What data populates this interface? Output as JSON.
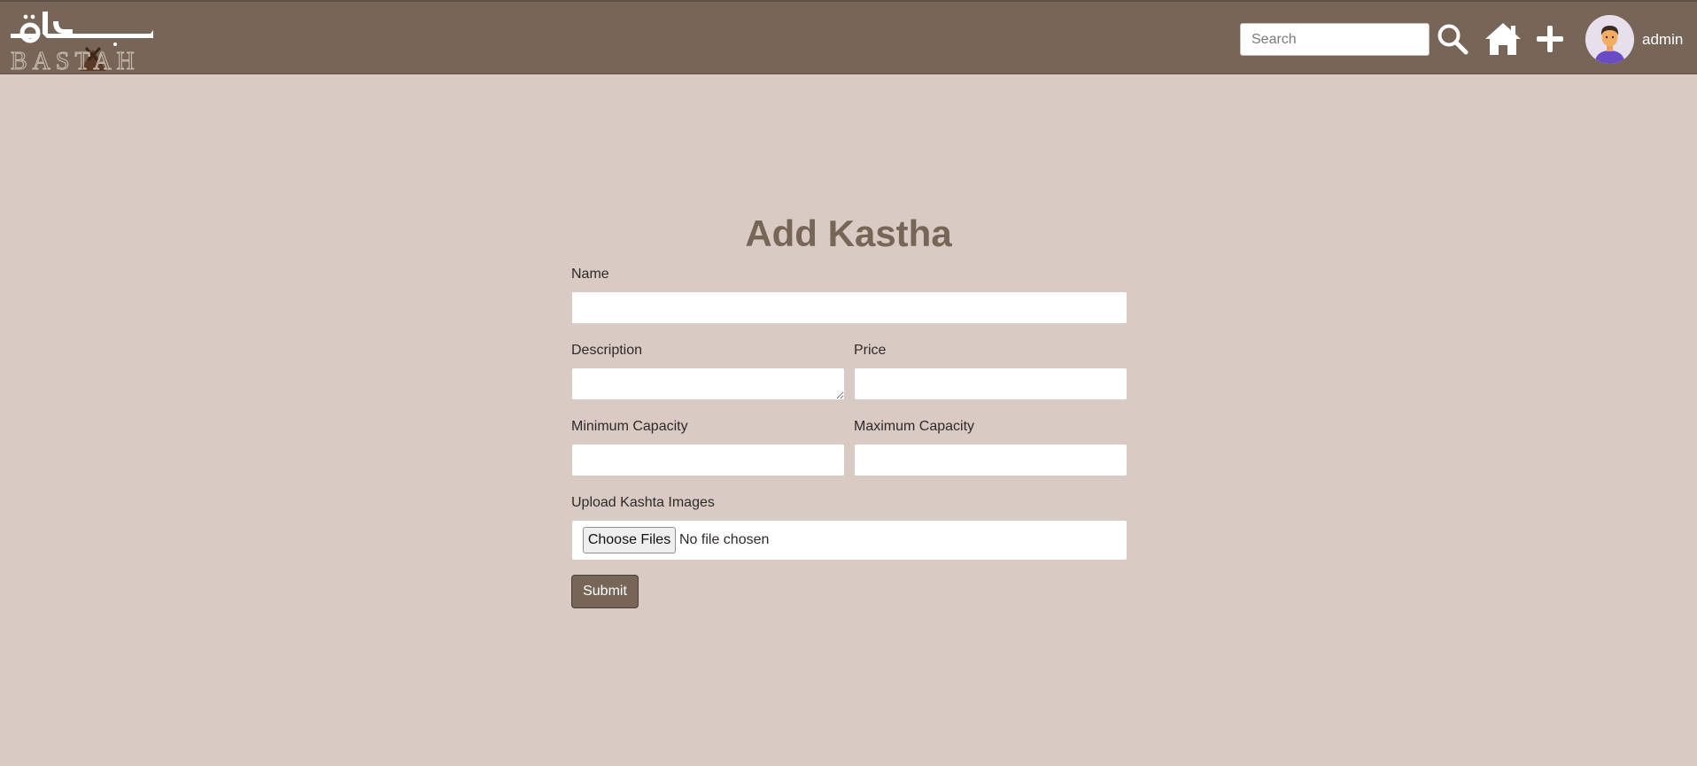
{
  "header": {
    "search_placeholder": "Search",
    "user_name": "admin",
    "icons": [
      "search-icon",
      "home-icon",
      "plus-icon",
      "avatar"
    ],
    "background_color": "#776558"
  },
  "form": {
    "title": "Add Kastha",
    "name_label": "Name",
    "description_label": "Description",
    "price_label": "Price",
    "min_capacity_label": "Minimum Capacity",
    "max_capacity_label": "Maximum Capacity",
    "upload_label": "Upload Kashta Images",
    "choose_files_label": "Choose Files",
    "file_status": "No file chosen",
    "submit_label": "Submit"
  },
  "colors": {
    "page_background": "#d9cbc4",
    "accent": "#776558"
  }
}
